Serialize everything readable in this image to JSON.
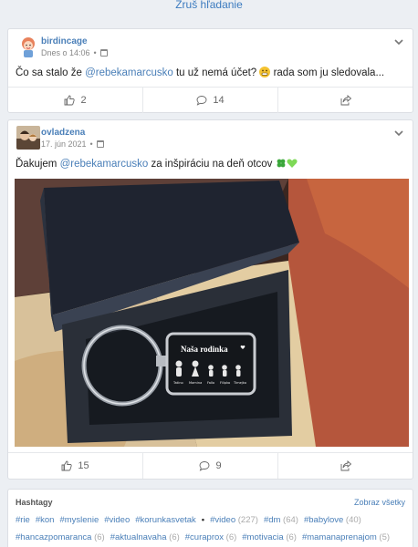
{
  "search": {
    "cancel_label": "Zruš hľadanie"
  },
  "posts": [
    {
      "author": "birdincage",
      "time": "Dnes o 14:06",
      "dot": "•",
      "text_before": "Čo sa stalo že ",
      "mention": "@rebekamarcusko",
      "text_after": " tu už nemá účet? ",
      "text_end": " rada som ju sledovala...",
      "likes": "2",
      "comments": "14"
    },
    {
      "author": "ovladzena",
      "time": "17. jún 2021",
      "dot": "•",
      "text_before": "Ďakujem ",
      "mention": "@rebekamarcusko",
      "text_after": " za inšpiráciu na deň otcov ",
      "photo_caption": "Naša rodinka",
      "photo_names": [
        "Tatino",
        "Mamina",
        "Fallo",
        "Filipko",
        "Timejko"
      ],
      "likes": "15",
      "comments": "9"
    }
  ],
  "hashtags": {
    "title": "Hashtagy",
    "show_all": "Zobraz všetky",
    "separator": "•",
    "row1_a": [
      {
        "tag": "#rie"
      },
      {
        "tag": "#kon"
      },
      {
        "tag": "#myslenie"
      },
      {
        "tag": "#video"
      },
      {
        "tag": "#korunkasvetak"
      }
    ],
    "row1_b": [
      {
        "tag": "#video",
        "count": "(227)"
      },
      {
        "tag": "#dm",
        "count": "(64)"
      },
      {
        "tag": "#babylove",
        "count": "(40)"
      }
    ],
    "row2": [
      {
        "tag": "#hancazpomaranca",
        "count": "(6)"
      },
      {
        "tag": "#aktualnavaha",
        "count": "(6)"
      },
      {
        "tag": "#curaprox",
        "count": "(6)"
      },
      {
        "tag": "#motivacia",
        "count": "(6)"
      },
      {
        "tag": "#mamanaprenajom",
        "count": "(5)"
      }
    ]
  },
  "colors": {
    "link": "#4a7fb8",
    "background": "#eceff3",
    "clover": "#3aa63a",
    "heart": "#7ed957"
  }
}
